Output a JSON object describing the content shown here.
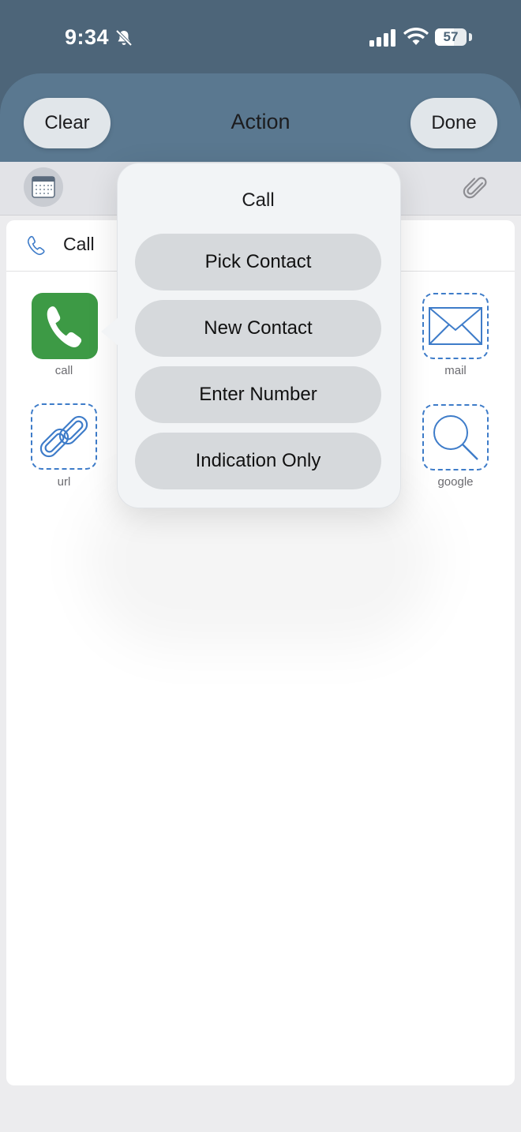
{
  "status_bar": {
    "time": "9:34",
    "battery": "57"
  },
  "nav": {
    "clear_label": "Clear",
    "title": "Action",
    "done_label": "Done"
  },
  "toolbar": {
    "calendar_icon": "calendar-icon",
    "attachment_icon": "paperclip-icon"
  },
  "content": {
    "section_label": "Call",
    "apps": [
      {
        "label": "call",
        "icon": "phone-icon"
      },
      {
        "label": "mail",
        "icon": "envelope-icon"
      },
      {
        "label": "url",
        "icon": "link-icon"
      },
      {
        "label": "google",
        "icon": "magnifier-icon"
      }
    ]
  },
  "popover": {
    "title": "Call",
    "options": [
      "Pick Contact",
      "New Contact",
      "Enter Number",
      "Indication Only"
    ]
  },
  "colors": {
    "header": "#4d6579",
    "accent_blue": "#3e7cc9",
    "call_green": "#3d9a45"
  }
}
